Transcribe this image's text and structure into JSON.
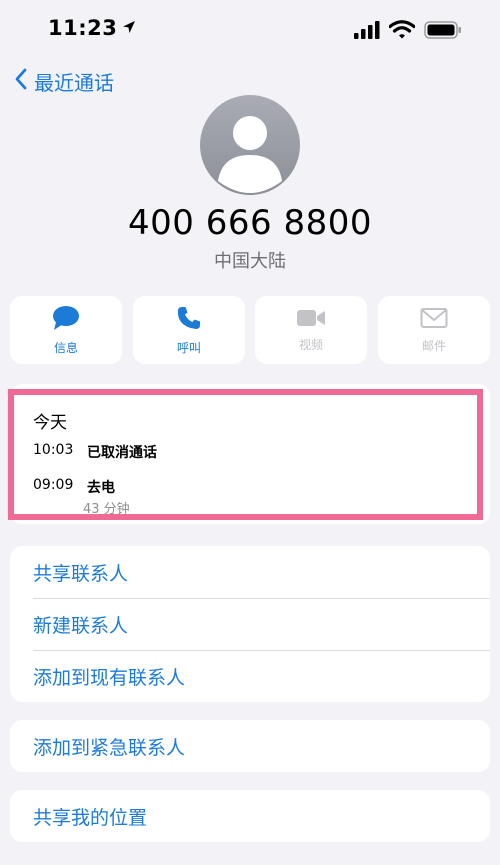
{
  "status_bar": {
    "time": "11:23"
  },
  "nav": {
    "back_label": "最近通话"
  },
  "contact": {
    "phone_number": "400 666 8800",
    "region": "中国大陆"
  },
  "actions": [
    {
      "label": "信息",
      "icon": "message-icon",
      "enabled": true
    },
    {
      "label": "呼叫",
      "icon": "phone-icon",
      "enabled": true
    },
    {
      "label": "视频",
      "icon": "video-icon",
      "enabled": false
    },
    {
      "label": "邮件",
      "icon": "mail-icon",
      "enabled": false
    }
  ],
  "recents": {
    "heading": "今天",
    "calls": [
      {
        "time": "10:03",
        "description": "已取消通话",
        "duration": ""
      },
      {
        "time": "09:09",
        "description": "去电",
        "duration": "43 分钟"
      }
    ]
  },
  "options": {
    "group1": [
      "共享联系人",
      "新建联系人",
      "添加到现有联系人"
    ],
    "group2": [
      "添加到紧急联系人"
    ],
    "group3": [
      "共享我的位置"
    ]
  },
  "colors": {
    "accent": "#1d7bd8",
    "highlight": "#ef6b95",
    "background": "#f2f2f7"
  }
}
